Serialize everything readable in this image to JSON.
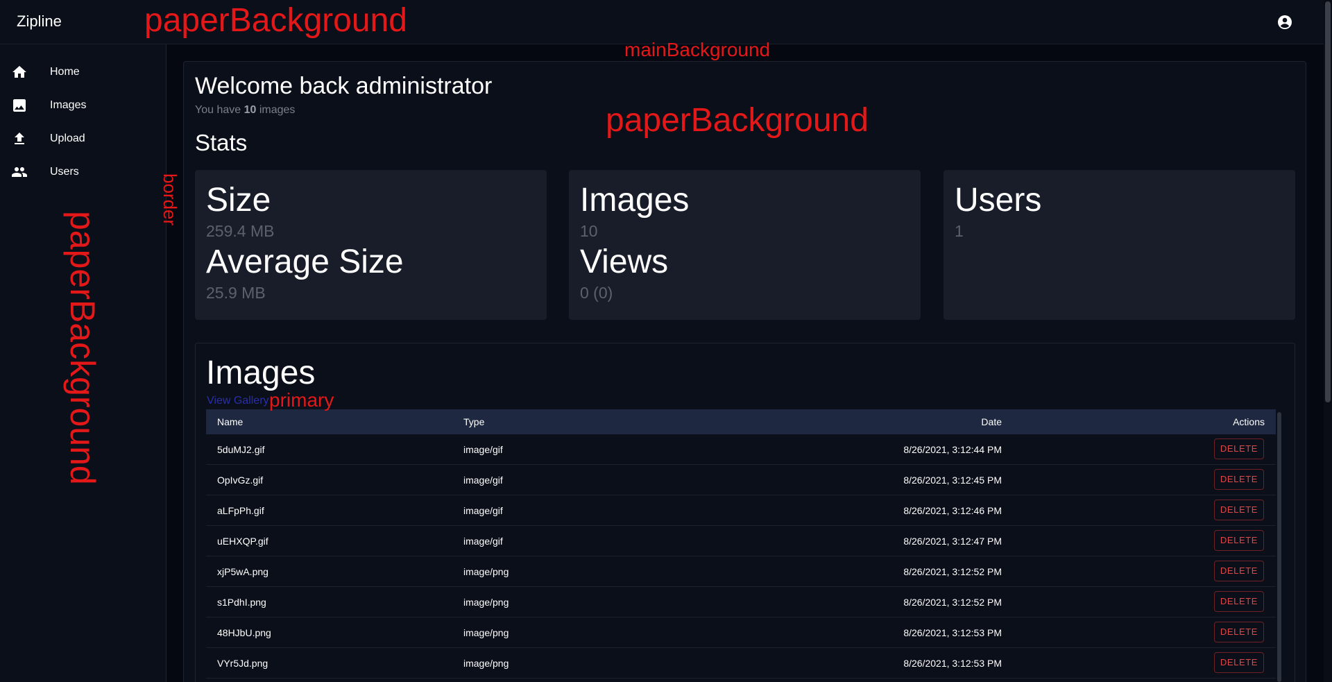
{
  "app": {
    "title": "Zipline"
  },
  "sidebar": {
    "items": [
      {
        "label": "Home",
        "icon": "home-icon"
      },
      {
        "label": "Images",
        "icon": "image-icon"
      },
      {
        "label": "Upload",
        "icon": "upload-icon"
      },
      {
        "label": "Users",
        "icon": "users-icon"
      }
    ]
  },
  "welcome": {
    "title": "Welcome back administrator",
    "prefix": "You have",
    "count": "10",
    "suffix": "images"
  },
  "stats": {
    "heading": "Stats",
    "cards": [
      {
        "label1": "Size",
        "value1": "259.4 MB",
        "label2": "Average Size",
        "value2": "25.9 MB"
      },
      {
        "label1": "Images",
        "value1": "10",
        "label2": "Views",
        "value2": "0 (0)"
      },
      {
        "label1": "Users",
        "value1": "1"
      }
    ]
  },
  "images": {
    "heading": "Images",
    "view_gallery": "View Gallery",
    "columns": {
      "name": "Name",
      "type": "Type",
      "date": "Date",
      "actions": "Actions"
    },
    "delete_label": "DELETE",
    "rows": [
      {
        "name": "5duMJ2.gif",
        "type": "image/gif",
        "date": "8/26/2021, 3:12:44 PM"
      },
      {
        "name": "OpIvGz.gif",
        "type": "image/gif",
        "date": "8/26/2021, 3:12:45 PM"
      },
      {
        "name": "aLFpPh.gif",
        "type": "image/gif",
        "date": "8/26/2021, 3:12:46 PM"
      },
      {
        "name": "uEHXQP.gif",
        "type": "image/gif",
        "date": "8/26/2021, 3:12:47 PM"
      },
      {
        "name": "xjP5wA.png",
        "type": "image/png",
        "date": "8/26/2021, 3:12:52 PM"
      },
      {
        "name": "s1PdhI.png",
        "type": "image/png",
        "date": "8/26/2021, 3:12:52 PM"
      },
      {
        "name": "48HJbU.png",
        "type": "image/png",
        "date": "8/26/2021, 3:12:53 PM"
      },
      {
        "name": "VYr5Jd.png",
        "type": "image/png",
        "date": "8/26/2021, 3:12:53 PM"
      }
    ]
  },
  "annotations": {
    "paper_top": "paperBackground",
    "main_bg": "mainBackground",
    "paper_mid": "paperBackground",
    "border": "border",
    "paper_side": "paperBackground",
    "primary": "primary"
  },
  "colors": {
    "main_background": "#050810",
    "paper_background": "#0b0f19",
    "card_background": "#191d29",
    "table_header": "#1e2840",
    "primary": "#2a2fa8",
    "danger": "#e04848",
    "annotation": "#e41818"
  }
}
